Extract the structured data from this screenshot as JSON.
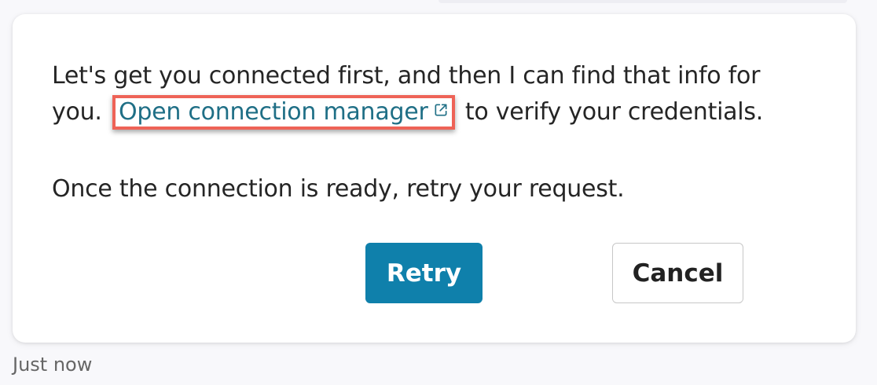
{
  "message": {
    "line1": "Let's get you connected first, and then I can find that info for",
    "line2_before": "you. ",
    "link_text": "Open connection manager",
    "line2_after": " to verify your credentials.",
    "line3": "Once the connection is ready, retry your request."
  },
  "actions": {
    "retry_label": "Retry",
    "cancel_label": "Cancel"
  },
  "meta": {
    "timestamp": "Just now"
  },
  "colors": {
    "accent": "#0f80ab",
    "link": "#1f6f86",
    "highlight": "#ee6357"
  },
  "icons": {
    "link": "external-link-icon"
  }
}
